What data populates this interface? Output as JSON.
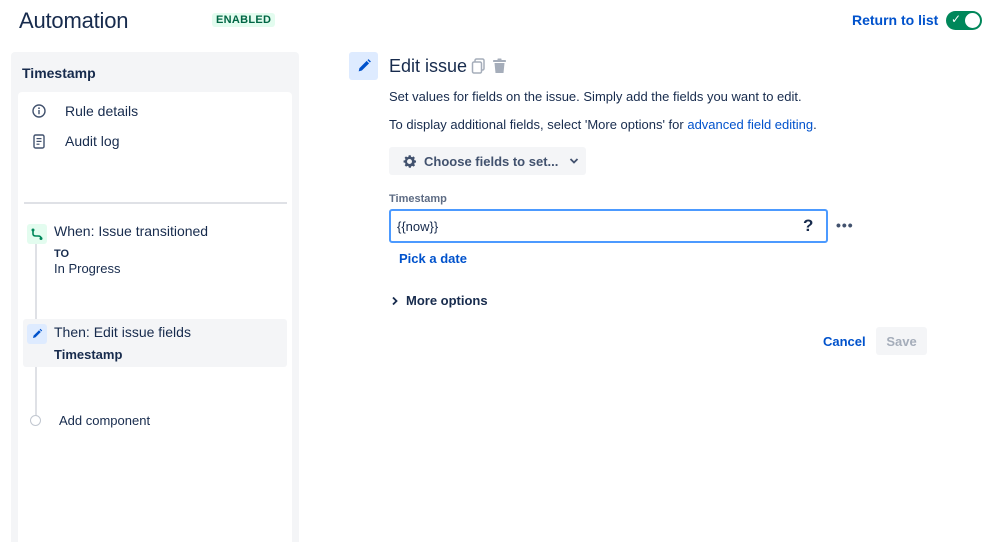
{
  "header": {
    "title": "Automation",
    "status_badge": "ENABLED",
    "return_link": "Return to list",
    "toggle_state": "on",
    "toggle_color": "#00875A"
  },
  "sidebar": {
    "title": "Timestamp",
    "links": [
      {
        "label": "Rule details",
        "icon": "info-icon"
      },
      {
        "label": "Audit log",
        "icon": "document-icon"
      }
    ],
    "trigger": {
      "title": "When: Issue transitioned",
      "keyword": "TO",
      "value": "In Progress",
      "icon": "transition-icon"
    },
    "action": {
      "title": "Then: Edit issue fields",
      "subtitle": "Timestamp",
      "icon": "pencil-icon"
    },
    "add_component": "Add component"
  },
  "main": {
    "title": "Edit issue",
    "description": "Set values for fields on the issue. Simply add the fields you want to edit.",
    "description2_prefix": "To display additional fields, select 'More options' for ",
    "description2_link": "advanced field editing",
    "description2_suffix": ".",
    "choose_fields_label": "Choose fields to set...",
    "field": {
      "label": "Timestamp",
      "value": "{{now}}",
      "help_symbol": "?",
      "more_symbol": "•••"
    },
    "pick_date_link": "Pick a date",
    "more_options_label": "More options",
    "cancel_label": "Cancel",
    "save_label": "Save",
    "accent_color": "#0052CC"
  }
}
